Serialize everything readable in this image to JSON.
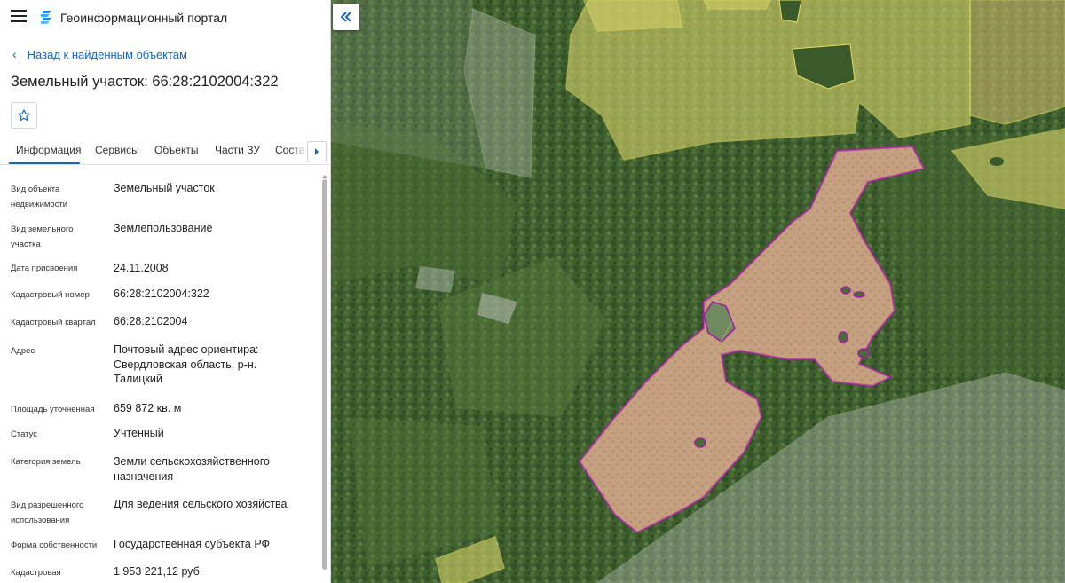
{
  "app": {
    "title": "Геоинформационный портал"
  },
  "back": {
    "label": "Назад к найденным объектам"
  },
  "object": {
    "title": "Земельный участок: 66:28:2102004:322"
  },
  "tabs": [
    {
      "label": "Информация"
    },
    {
      "label": "Сервисы"
    },
    {
      "label": "Объекты"
    },
    {
      "label": "Части ЗУ"
    },
    {
      "label": "Состав"
    }
  ],
  "info": [
    {
      "label": "Вид объекта недвижимости",
      "value": "Земельный участок"
    },
    {
      "label": "Вид земельного участка",
      "value": "Землепользование"
    },
    {
      "label": "Дата присвоения",
      "value": "24.11.2008"
    },
    {
      "label": "Кадастровый номер",
      "value": "66:28:2102004:322"
    },
    {
      "label": "Кадастровый квартал",
      "value": "66:28:2102004"
    },
    {
      "label": "Адрес",
      "value": "Почтовый адрес ориентира: Свердловская область, р-н. Талицкий"
    },
    {
      "label": "Площадь уточненная",
      "value": "659 872 кв. м"
    },
    {
      "label": "Статус",
      "value": "Учтенный"
    },
    {
      "label": "Категория земель",
      "value": "Земли сельскохозяйственного назначения"
    },
    {
      "label": "Вид разрешенного использования",
      "value": "Для ведения сельского хозяйства"
    },
    {
      "label": "Форма собственности",
      "value": "Государственная субъекта РФ"
    },
    {
      "label": "Кадастровая",
      "value": "1 953 221,12 руб."
    }
  ],
  "colors": {
    "accent": "#1565c0",
    "parcel_highlight": "#a020a0",
    "parcel_fill": "#d09090",
    "neighbor_parcel": "#e8e060"
  },
  "icons": {
    "menu": "hamburger-icon",
    "logo": "portal-logo-icon",
    "back": "chevron-left-icon",
    "favorite": "star-icon",
    "tabs_next": "chevron-right-icon",
    "collapse": "double-chevron-left-icon"
  }
}
